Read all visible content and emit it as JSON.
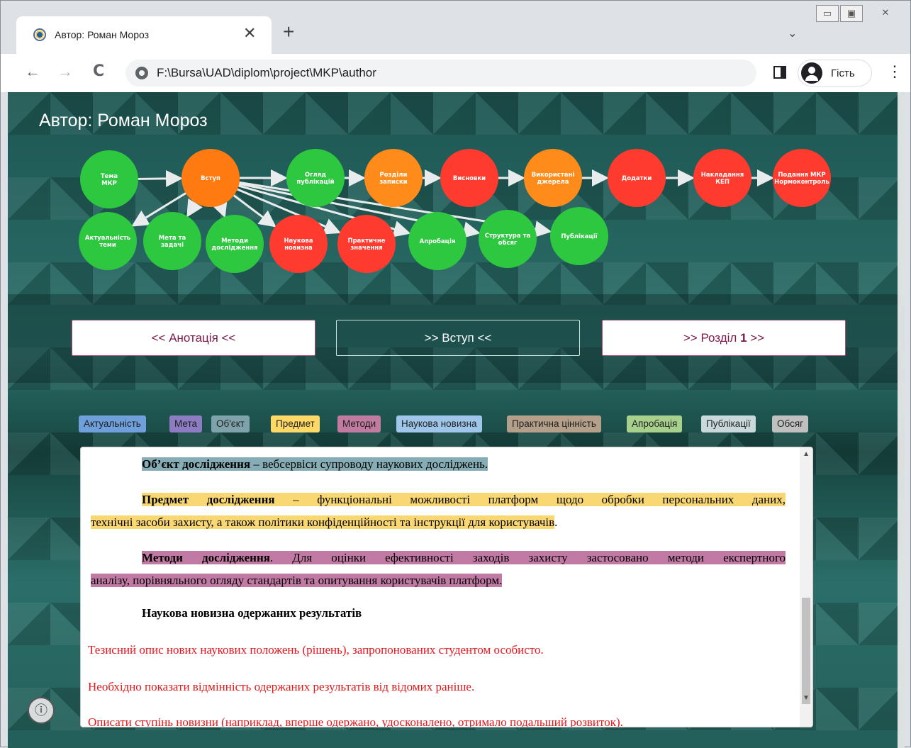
{
  "browser": {
    "tab_title": "Автор: Роман Мороз",
    "tab_close": "✕",
    "new_tab": "+",
    "tab_search": "⌄",
    "win_min": "▭",
    "win_max": "▣",
    "win_close": "✕",
    "back": "←",
    "forward": "→",
    "reload": "C",
    "url": "F:\\Bursa\\UAD\\diplom\\project\\MKP\\author",
    "profile_label": "Гість",
    "menu": "⋮"
  },
  "page": {
    "title": "Автор: Роман Мороз",
    "flow_nodes": [
      {
        "label": "Тема МКР",
        "status": "done",
        "color": "#2ec740"
      },
      {
        "label": "Вступ",
        "status": "current",
        "color": "#ff7a10"
      },
      {
        "label": "Огляд публікацій",
        "status": "done",
        "color": "#2ec740"
      },
      {
        "label": "Розділи записки",
        "status": "progress",
        "color": "#ff8c1a"
      },
      {
        "label": "Висновки",
        "status": "todo",
        "color": "#ff3b30"
      },
      {
        "label": "Використані джерела",
        "status": "progress",
        "color": "#ff8c1a"
      },
      {
        "label": "Додатки",
        "status": "todo",
        "color": "#ff3b30"
      },
      {
        "label": "Накладання КЕП",
        "status": "todo",
        "color": "#ff3b30"
      },
      {
        "label": "Подання МКР Нормоконтроль",
        "status": "todo",
        "color": "#ff3b30"
      },
      {
        "label": "Актуальність теми",
        "status": "done",
        "color": "#2ec740"
      },
      {
        "label": "Мета та задачі",
        "status": "done",
        "color": "#2ec740"
      },
      {
        "label": "Методи дослідження",
        "status": "done",
        "color": "#2ec740"
      },
      {
        "label": "Наукова новизна",
        "status": "todo",
        "color": "#ff3b30"
      },
      {
        "label": "Практичне значення",
        "status": "todo",
        "color": "#ff3b30"
      },
      {
        "label": "Апробація",
        "status": "done",
        "color": "#2ec740"
      },
      {
        "label": "Структура та обсяг",
        "status": "done",
        "color": "#2ec740"
      },
      {
        "label": "Публікації",
        "status": "done",
        "color": "#2ec740"
      }
    ],
    "nav": {
      "prev": "<< Анотація <<",
      "current": ">> Вступ <<",
      "next_prefix": ">> Розділ ",
      "next_num": "1",
      "next_suffix": " >>"
    },
    "tags": [
      {
        "label": "Актуальність",
        "color": "#6fa0dc"
      },
      {
        "label": "Мета",
        "color": "#8e7cc3"
      },
      {
        "label": "Об'єкт",
        "color": "#7fa3ab"
      },
      {
        "label": "Предмет",
        "color": "#ffd966"
      },
      {
        "label": "Методи",
        "color": "#c27ba0"
      },
      {
        "label": "Наукова новизна",
        "color": "#9fc5e8"
      },
      {
        "label": "Практична цінність",
        "color": "#b4a08a"
      },
      {
        "label": "Апробація",
        "color": "#a8d08d"
      },
      {
        "label": "Публікації",
        "color": "#c9d8db"
      },
      {
        "label": "Обсяг",
        "color": "#c0c0c0"
      }
    ],
    "document": {
      "object_bold": "Об’єкт дослідження",
      "object_text": " – вебсервіси супроводу наукових досліджень.",
      "subject_bold": "Предмет дослідження",
      "subject_line1": " –  функціональні можливості платформ щодо обробки персональних даних,",
      "subject_line2": "технічні засоби захисту, а також політики конфіденційності та інструкції для користувачів",
      "subject_end": ".",
      "methods_bold": "Методи дослідження",
      "methods_line1": ". Для оцінки ефективності заходів захисту застосовано методи експертного",
      "methods_line2": "аналізу, порівняльного огляду стандартів та опитування користувачів платформ.",
      "novelty_heading": "Наукова новизна одержаних результатів",
      "red1": "Тезисний опис нових наукових положень (рішень), запропонованих студентом особисто.",
      "red2": "Необхідно показати відмінність одержаних результатів від відомих раніше.",
      "red3": "Описати ступінь новизни (наприклад, вперше одержано, удосконалено, отримало подальший розвиток)."
    },
    "info_icon": "ⓘ"
  }
}
